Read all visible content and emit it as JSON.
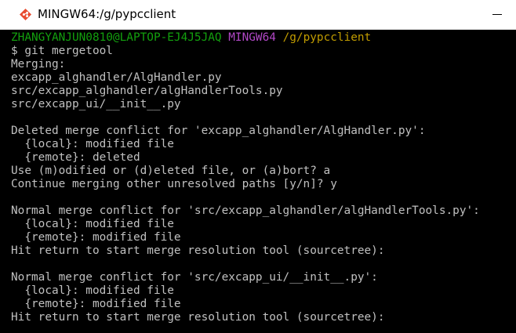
{
  "window": {
    "title": "MINGW64:/g/pypcclient",
    "accent": "#e84d31"
  },
  "colors": {
    "background": "#000000",
    "text": "#c0c0c0",
    "prompt_user": "#13a10e",
    "prompt_system": "#b148c6",
    "prompt_path": "#c19c00"
  },
  "terminal": {
    "prompt": {
      "user": "ZHANGYANJUN0810@LAPTOP-EJ4J5JAQ",
      "system": "MINGW64",
      "path": "/g/pypcclient"
    },
    "lines": [
      "$ git mergetool",
      "Merging:",
      "excapp_alghandler/AlgHandler.py",
      "src/excapp_alghandler/algHandlerTools.py",
      "src/excapp_ui/__init__.py",
      "",
      "Deleted merge conflict for 'excapp_alghandler/AlgHandler.py':",
      "  {local}: modified file",
      "  {remote}: deleted",
      "Use (m)odified or (d)eleted file, or (a)bort? a",
      "Continue merging other unresolved paths [y/n]? y",
      "",
      "Normal merge conflict for 'src/excapp_alghandler/algHandlerTools.py':",
      "  {local}: modified file",
      "  {remote}: modified file",
      "Hit return to start merge resolution tool (sourcetree):",
      "",
      "Normal merge conflict for 'src/excapp_ui/__init__.py':",
      "  {local}: modified file",
      "  {remote}: modified file",
      "Hit return to start merge resolution tool (sourcetree):"
    ]
  }
}
